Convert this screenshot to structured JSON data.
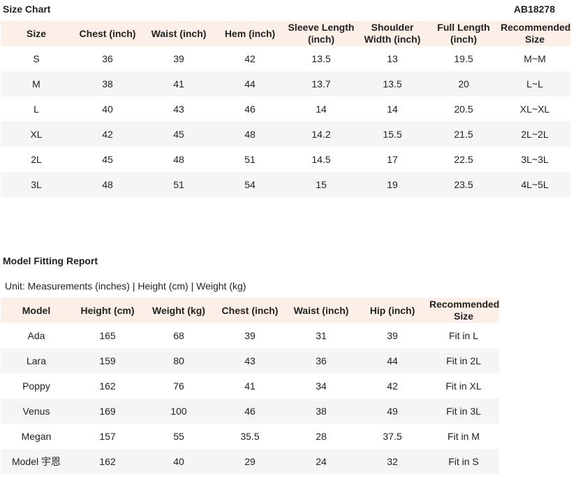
{
  "size_chart": {
    "title": "Size Chart",
    "code": "AB18278",
    "headers": [
      "Size",
      "Chest (inch)",
      "Waist  (inch)",
      "Hem (inch)",
      "Sleeve Length  (inch)",
      "Shoulder Width (inch)",
      "Full Length (inch)",
      "Recommended Size"
    ],
    "rows": [
      [
        "S",
        "36",
        "39",
        "42",
        "13.5",
        "13",
        "19.5",
        "M~M"
      ],
      [
        "M",
        "38",
        "41",
        "44",
        "13.7",
        "13.5",
        "20",
        "L~L"
      ],
      [
        "L",
        "40",
        "43",
        "46",
        "14",
        "14",
        "20.5",
        "XL~XL"
      ],
      [
        "XL",
        "42",
        "45",
        "48",
        "14.2",
        "15.5",
        "21.5",
        "2L~2L"
      ],
      [
        "2L",
        "45",
        "48",
        "51",
        "14.5",
        "17",
        "22.5",
        "3L~3L"
      ],
      [
        "3L",
        "48",
        "51",
        "54",
        "15",
        "19",
        "23.5",
        "4L~5L"
      ]
    ]
  },
  "model_report": {
    "title": "Model Fitting Report",
    "unit_note": "Unit: Measurements (inches) | Height (cm) | Weight (kg)",
    "headers": [
      "Model",
      "Height (cm)",
      "Weight (kg)",
      "Chest (inch)",
      "Waist (inch)",
      "Hip (inch)",
      "Recommended Size"
    ],
    "rows": [
      [
        "Ada",
        "165",
        "68",
        "39",
        "31",
        "39",
        "Fit in L"
      ],
      [
        "Lara",
        "159",
        "80",
        "43",
        "36",
        "44",
        "Fit in 2L"
      ],
      [
        "Poppy",
        "162",
        "76",
        "41",
        "34",
        "42",
        "Fit in XL"
      ],
      [
        "Venus",
        "169",
        "100",
        "46",
        "38",
        "49",
        "Fit in 3L"
      ],
      [
        "Megan",
        "157",
        "55",
        "35.5",
        "28",
        "37.5",
        "Fit in M"
      ],
      [
        "Model 宇恩",
        "162",
        "40",
        "29",
        "24",
        "32",
        "Fit in S"
      ]
    ]
  }
}
